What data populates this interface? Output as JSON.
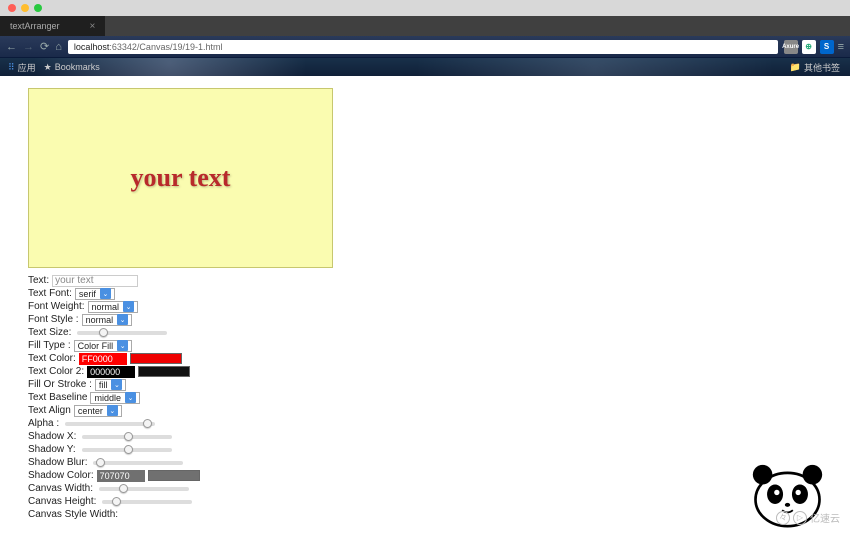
{
  "window": {
    "tab_title": "textArranger"
  },
  "address": {
    "url_host": "localhost",
    "url_path": ":63342/Canvas/19/19-1.html",
    "ext_label": "Axure"
  },
  "bookmarks": {
    "apps": "应用",
    "bm1": "Bookmarks",
    "other": "其他书签"
  },
  "canvas": {
    "text": "your text"
  },
  "controls": {
    "text_label": "Text:",
    "text_value": "your text",
    "font_label": "Text Font:",
    "font_value": "serif",
    "weight_label": "Font Weight:",
    "weight_value": "normal",
    "style_label": "Font Style :",
    "style_value": "normal",
    "size_label": "Text Size:",
    "filltype_label": "Fill Type :",
    "filltype_value": "Color Fill",
    "color_label": "Text Color:",
    "color_value": "FF0000",
    "color2_label": "Text Color 2:",
    "color2_value": "000000",
    "fos_label": "Fill Or Stroke :",
    "fos_value": "fill",
    "baseline_label": "Text Baseline",
    "baseline_value": "middle",
    "align_label": "Text Align",
    "align_value": "center",
    "alpha_label": "Alpha :",
    "shx_label": "Shadow X:",
    "shy_label": "Shadow Y:",
    "shblur_label": "Shadow Blur:",
    "shcolor_label": "Shadow Color:",
    "shcolor_value": "707070",
    "cw_label": "Canvas Width:",
    "ch_label": "Canvas Height:",
    "csw_label": "Canvas Style Width:"
  },
  "watermark": {
    "text": "亿速云"
  }
}
